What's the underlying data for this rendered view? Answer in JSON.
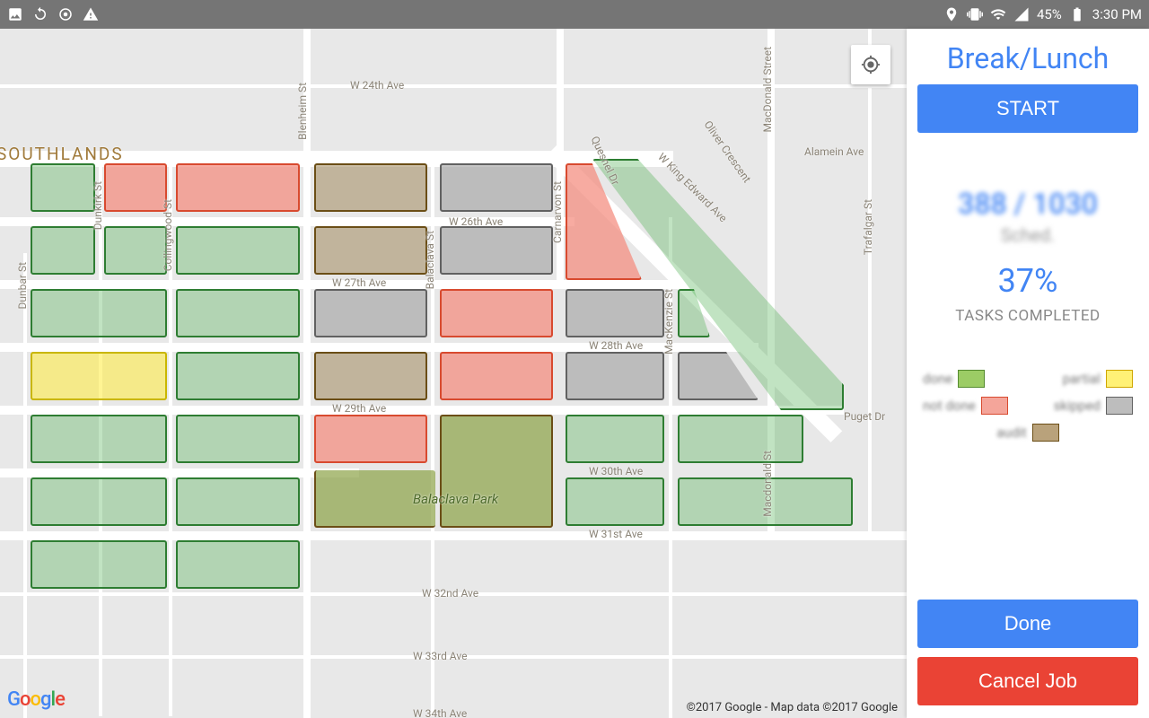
{
  "statusbar": {
    "battery": "45%",
    "time": "3:30 PM"
  },
  "map": {
    "region_label": "SOUTHLANDS",
    "attribution": "©2017 Google - Map data ©2017 Google",
    "park_name": "Balaclava Park",
    "streets": {
      "w24": "W 24th Ave",
      "w26": "W 26th Ave",
      "w27": "W 27th Ave",
      "w28": "W 28th Ave",
      "w29": "W 29th Ave",
      "w30": "W 30th Ave",
      "w31": "W 31st Ave",
      "w32": "W 32nd Ave",
      "w33": "W 33rd Ave",
      "w34": "W 34th Ave",
      "dunbar": "Dunbar St",
      "dunkirk": "Dunkirk St",
      "collingwood": "Collingwood St",
      "blenheim": "Blenheim St",
      "balaclava": "Balaclava St",
      "carnarvon": "Carnarvon St",
      "quesnel": "Quesnel Dr",
      "mackenzie": "MacKenzie St",
      "macdonald": "Macdonald St",
      "macdonald_street": "MacDonald Street",
      "trafalgar": "Trafalgar St",
      "king_edward": "W King Edward Ave",
      "alamein": "Alamein Ave",
      "oliver": "Oliver Crescent",
      "puget": "Puget Dr"
    }
  },
  "sidebar": {
    "title": "Break/Lunch",
    "start": "START",
    "counts": "388 / 1030",
    "sched": "Sched.",
    "percent": "37%",
    "tasks_completed": "TASKS COMPLETED",
    "done": "Done",
    "cancel": "Cancel Job",
    "legend": {
      "done": "done",
      "partial": "partial",
      "notdone": "not done",
      "skipped": "skipped",
      "audit": "audit"
    }
  }
}
